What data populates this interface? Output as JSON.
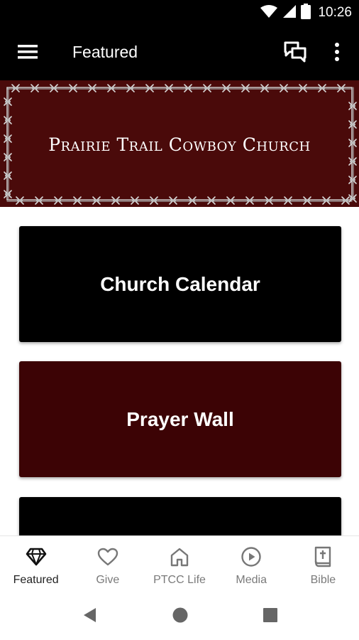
{
  "status_bar": {
    "time": "10:26",
    "icons": [
      "wifi-icon",
      "signal-icon",
      "battery-icon"
    ]
  },
  "app_bar": {
    "title": "Featured",
    "menu_icon": "menu-icon",
    "chat_icon": "chat-icon",
    "more_icon": "more-vert-icon"
  },
  "banner": {
    "title": "Prairie Trail Cowboy Church",
    "background_color": "#4a0a0a",
    "border_style": "barbed-wire"
  },
  "cards": [
    {
      "label": "Church Calendar",
      "color": "#000000"
    },
    {
      "label": "Prayer Wall",
      "color": "#3c0305"
    },
    {
      "label": "",
      "color": "#000000"
    }
  ],
  "bottom_nav": {
    "items": [
      {
        "label": "Featured",
        "icon": "diamond-icon",
        "active": true
      },
      {
        "label": "Give",
        "icon": "heart-icon",
        "active": false
      },
      {
        "label": "PTCC Life",
        "icon": "home-icon",
        "active": false
      },
      {
        "label": "Media",
        "icon": "play-circle-icon",
        "active": false
      },
      {
        "label": "Bible",
        "icon": "bible-icon",
        "active": false
      }
    ]
  },
  "system_nav": {
    "icons": [
      "back-icon",
      "home-circle-icon",
      "recents-icon"
    ]
  }
}
